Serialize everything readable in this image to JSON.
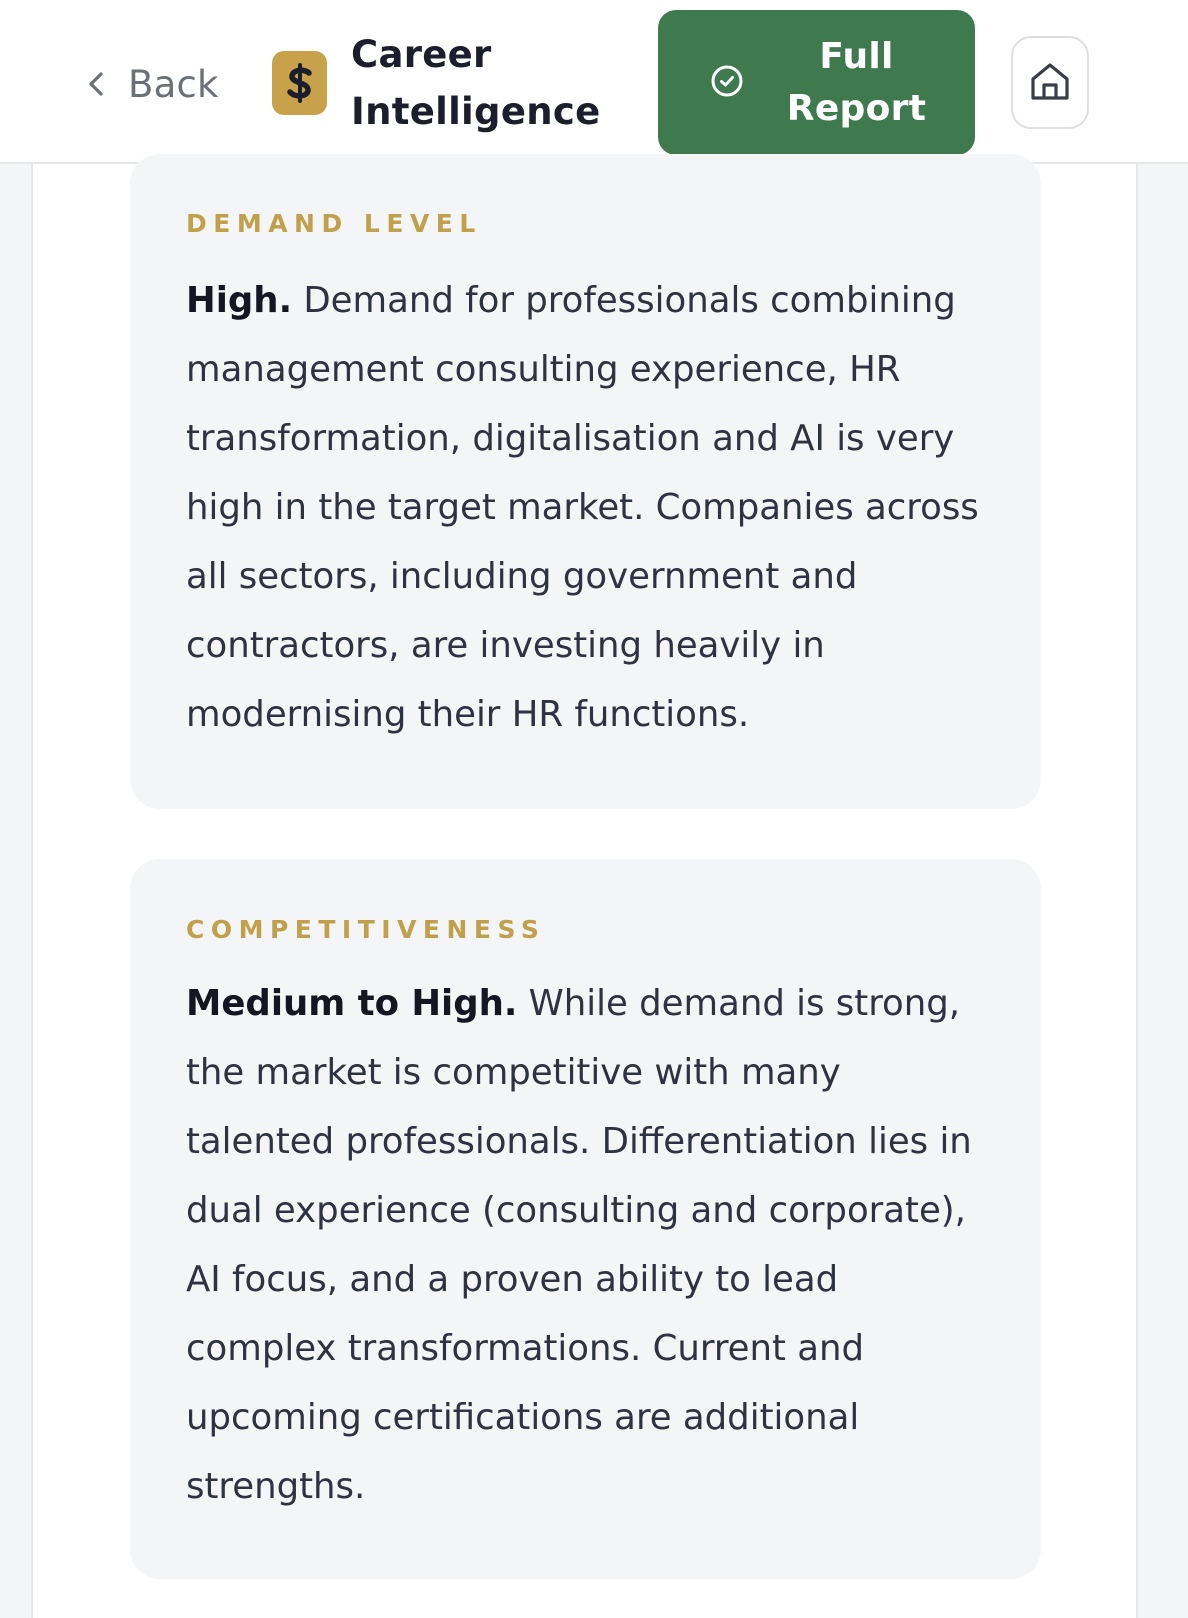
{
  "header": {
    "back_label": "Back",
    "brand_icon": "dollar-sign-icon",
    "title": "Career Intelligence",
    "full_report_label": "Full Report",
    "full_report_icon": "check-circle-icon",
    "home_icon": "home-icon"
  },
  "colors": {
    "accent_gold": "#c8a24a",
    "button_green": "#3f7a4f",
    "card_background": "#f4f5f7"
  },
  "cards": [
    {
      "label": "DEMAND LEVEL",
      "lead": "High.",
      "body": " Demand for professionals combining management consulting experience, HR transformation, digitalisation and AI is very high in the target market. Companies across all sectors, including government and contractors, are investing heavily in modernising their HR functions."
    },
    {
      "label": "COMPETITIVENESS",
      "lead": "Medium to High.",
      "body": " While demand is strong, the market is competitive with many talented professionals. Differentiation lies in dual experience (consulting and corporate), AI focus, and a proven ability to lead complex transformations. Current and upcoming certifications are additional strengths."
    }
  ]
}
